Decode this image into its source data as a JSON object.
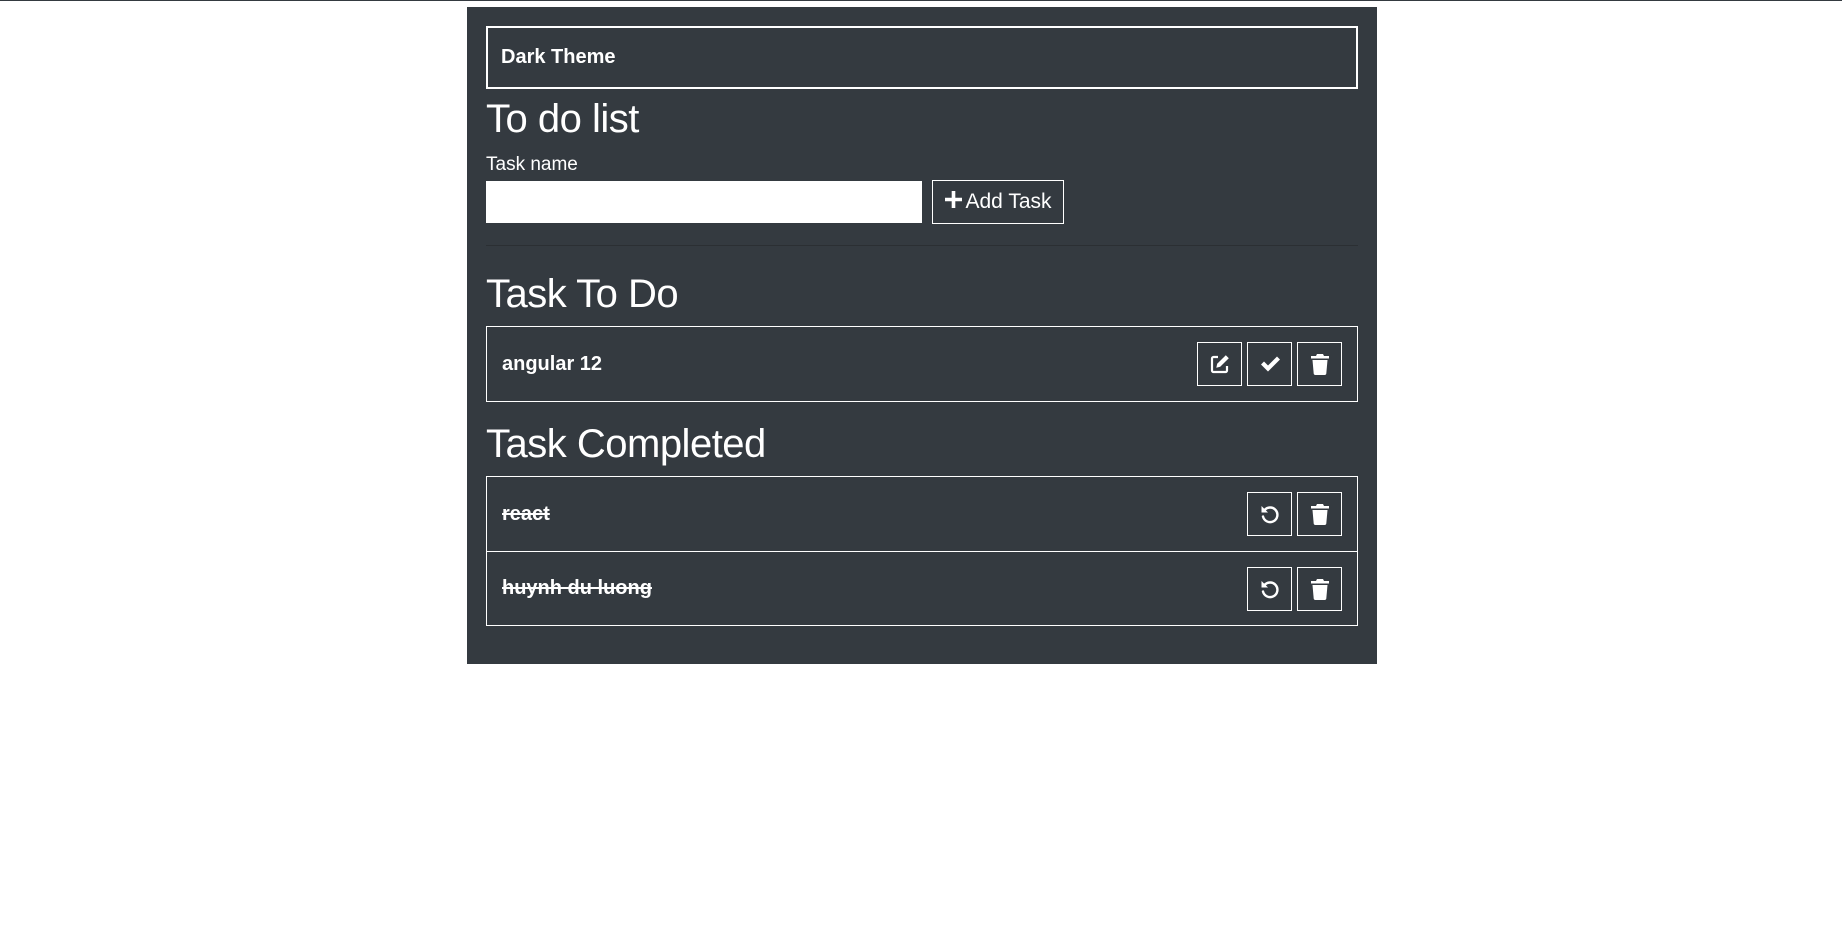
{
  "theme_bar": {
    "label": "Dark Theme"
  },
  "app": {
    "title": "To do list"
  },
  "form": {
    "label": "Task name",
    "input_value": "",
    "add_button_label": "Add Task"
  },
  "todo": {
    "title": "Task To Do",
    "items": [
      {
        "name": "angular 12"
      }
    ]
  },
  "completed": {
    "title": "Task Completed",
    "items": [
      {
        "name": "react"
      },
      {
        "name": "huynh du luong"
      }
    ]
  },
  "icons": {
    "add": "plus-icon",
    "edit": "edit-icon",
    "complete": "check-icon",
    "delete": "trash-icon",
    "restore": "undo-icon"
  },
  "colors": {
    "card_bg": "#343a40",
    "foreground": "#ffffff"
  }
}
